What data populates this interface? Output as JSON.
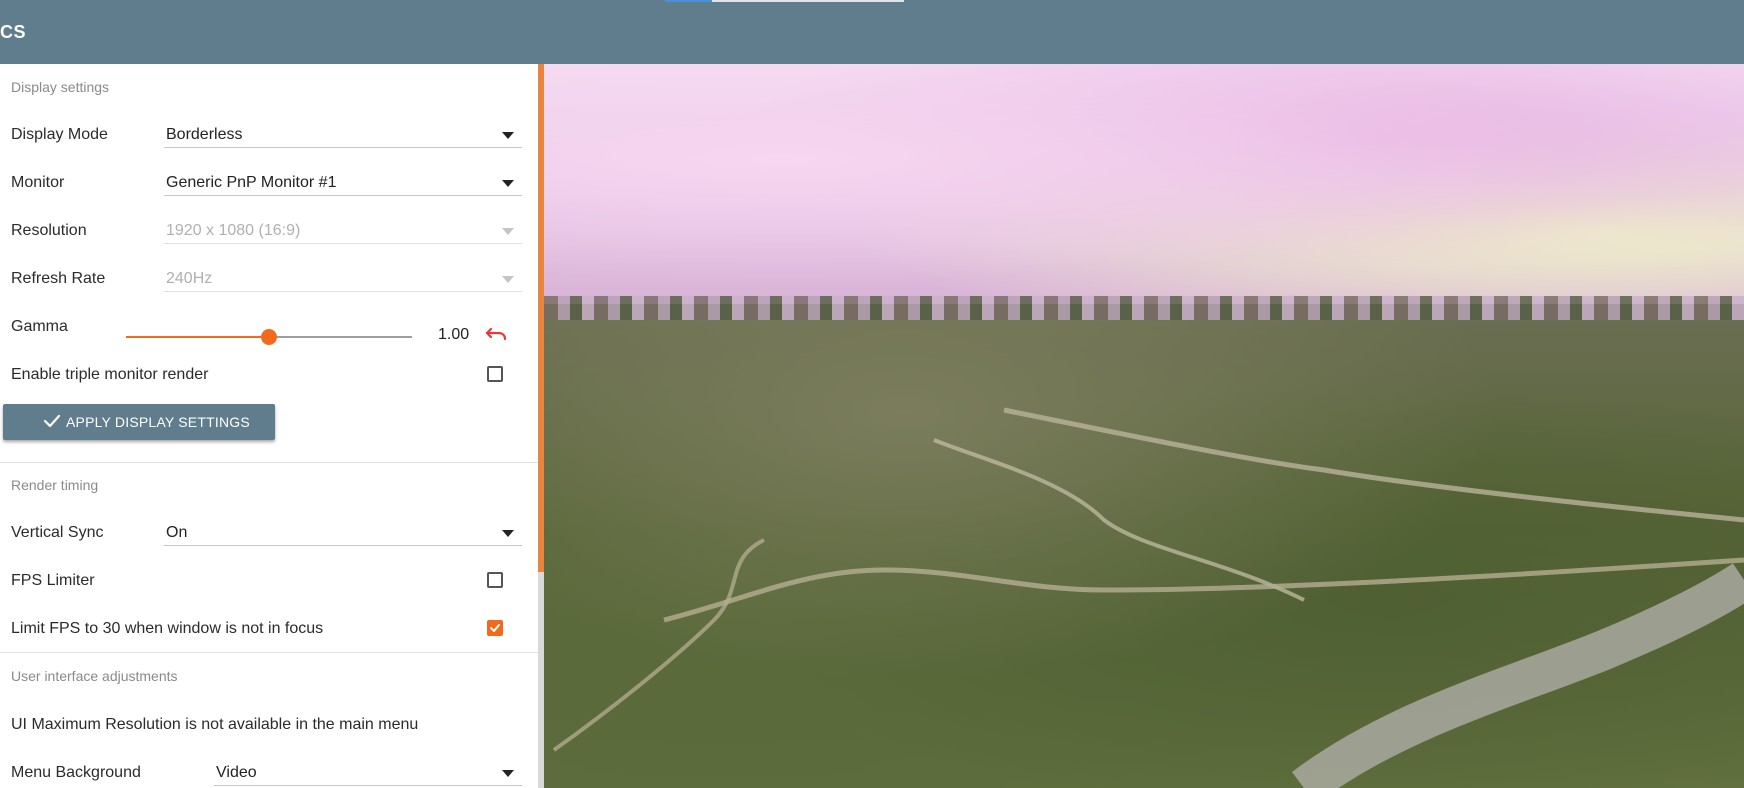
{
  "window": {
    "title_fragment": "CS"
  },
  "sections": {
    "display": {
      "title": "Display settings",
      "display_mode": {
        "label": "Display Mode",
        "value": "Borderless"
      },
      "monitor": {
        "label": "Monitor",
        "value": "Generic PnP Monitor #1"
      },
      "resolution": {
        "label": "Resolution",
        "value": "1920 x 1080 (16:9)",
        "disabled": true
      },
      "refresh_rate": {
        "label": "Refresh Rate",
        "value": "240Hz",
        "disabled": true
      },
      "gamma": {
        "label": "Gamma",
        "value": "1.00",
        "slider_fraction": 0.5
      },
      "triple_monitor": {
        "label": "Enable triple monitor render",
        "checked": false
      },
      "apply_button": {
        "label": "APPLY DISPLAY SETTINGS"
      }
    },
    "render_timing": {
      "title": "Render timing",
      "vertical_sync": {
        "label": "Vertical Sync",
        "value": "On"
      },
      "fps_limiter": {
        "label": "FPS Limiter",
        "checked": false
      },
      "limit_fps_unfocused": {
        "label": "Limit FPS to 30 when window is not in focus",
        "checked": true
      }
    },
    "ui_adjustments": {
      "title": "User interface adjustments",
      "note": "UI Maximum Resolution is not available in the main menu",
      "menu_background": {
        "label": "Menu Background",
        "value": "Video"
      }
    }
  },
  "colors": {
    "accent": "#f26b1d",
    "header": "#5f7d8c",
    "scroll_thumb": "#e8843c"
  }
}
